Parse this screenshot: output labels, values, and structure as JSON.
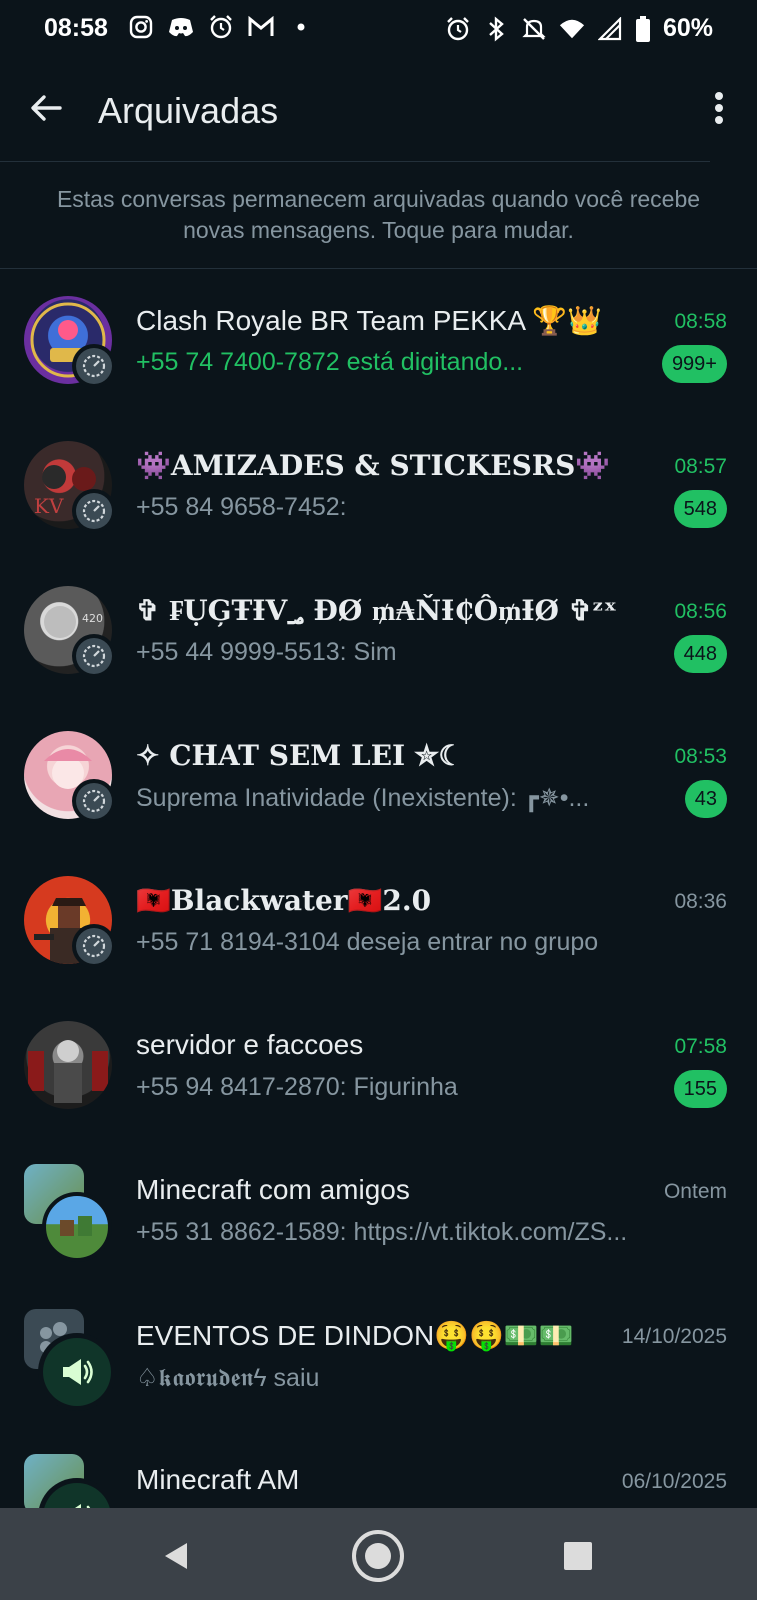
{
  "status_bar": {
    "time": "08:58",
    "battery": "60%"
  },
  "header": {
    "title": "Arquivadas"
  },
  "info_text": "Estas conversas permanecem arquivadas quando você recebe novas mensagens. Toque para mudar.",
  "chats": [
    {
      "name": "Clash Royale BR Team PEKKA 🏆👑",
      "preview": "+55 74 7400-7872 está digitando...",
      "time": "08:58",
      "count": "999+"
    },
    {
      "name": "👾AMIZADES & STICKESRS👾",
      "preview": "+55 84 9658-7452:",
      "time": "08:57",
      "count": "548"
    },
    {
      "name": "✞ ₣ỤĢŦƗV؃ ĐØ ₥₳ŇƗ₵Ô₥ƗØ ✞ᶻˣ",
      "preview": "+55 44 9999-5513: Sim",
      "time": "08:56",
      "count": "448"
    },
    {
      "name": "✧ CHAT SEM LEI ✮☾",
      "preview": "Suprema Inatividade (Inexistente): ┏✵•...",
      "time": "08:53",
      "count": "43"
    },
    {
      "name": "🇦🇱Blackwater🇦🇱2.0",
      "preview": "+55 71 8194-3104 deseja entrar no grupo",
      "time": "08:36",
      "count": ""
    },
    {
      "name": "servidor e faccoes",
      "preview": "+55 94 8417-2870:  Figurinha",
      "time": "07:58",
      "count": "155"
    },
    {
      "name": "Minecraft com amigos",
      "preview": "+55 31 8862-1589: https://vt.tiktok.com/ZS...",
      "time": "Ontem",
      "count": ""
    },
    {
      "name": "EVENTOS DE DINDON🤑🤑💵💵",
      "preview": "♤𝖐𝖆𝖔𝖗𝖚𝖉𝖊𝖓ϟ saiu",
      "time": "14/10/2025",
      "count": ""
    },
    {
      "name": "Minecraft AM",
      "preview": "",
      "time": "06/10/2025",
      "count": ""
    }
  ],
  "colors": {
    "background": "#0b141a",
    "accent": "#21c063",
    "muted": "#8696a0",
    "navbar": "#3b4148"
  }
}
